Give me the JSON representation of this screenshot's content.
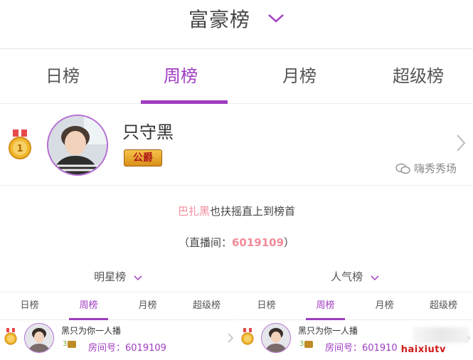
{
  "header": {
    "title": "富豪榜"
  },
  "tabs": [
    {
      "label": "日榜"
    },
    {
      "label": "周榜"
    },
    {
      "label": "月榜"
    },
    {
      "label": "超级榜"
    }
  ],
  "top_user": {
    "name": "只守黑",
    "badge": "公爵",
    "rank": 1
  },
  "watermark": "嗨秀秀场",
  "notice": {
    "highlight": "巴扎黑",
    "text": "也扶摇直上到榜首"
  },
  "room_info": {
    "prefix": "（直播间：",
    "number": "6019109",
    "suffix": "）"
  },
  "panels": [
    {
      "title": "明星榜",
      "tabs": [
        "日榜",
        "周榜",
        "月榜",
        "超级榜"
      ],
      "entry": {
        "name": "黑只为你一人播",
        "level": "3",
        "room_label": "房间号：",
        "room_number": "6019109"
      }
    },
    {
      "title": "人气榜",
      "tabs": [
        "日榜",
        "周榜",
        "月榜",
        "超级榜"
      ],
      "entry": {
        "name": "黑只为你一人播",
        "level": "3",
        "room_label": "房间号：",
        "room_number": "601910"
      }
    }
  ],
  "footer_watermark": "haixiutv",
  "colors": {
    "accent": "#a03cc0",
    "highlight": "#f28b9a"
  }
}
